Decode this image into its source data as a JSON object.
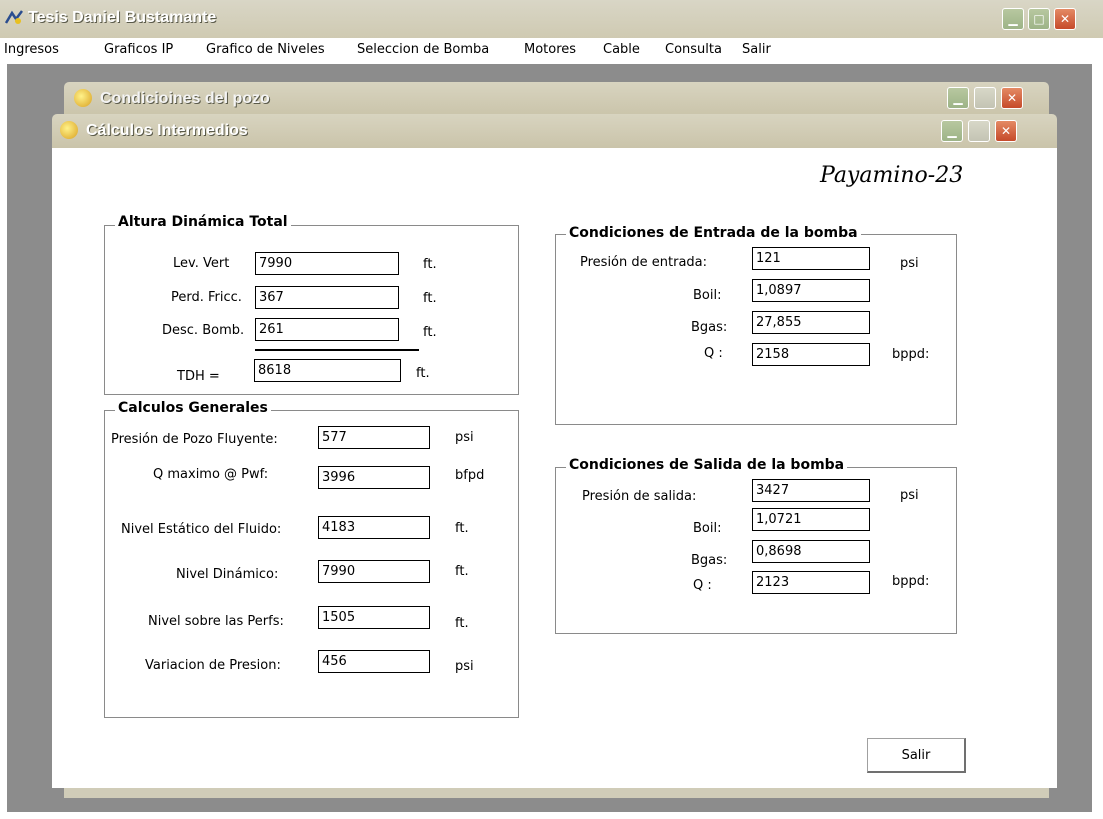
{
  "main_window": {
    "title": "Tesis Daniel Bustamante"
  },
  "menu": [
    "Ingresos",
    "Graficos IP",
    "Grafico de Niveles",
    "Seleccion de Bomba",
    "Motores",
    "Cable",
    "Consulta",
    "Salir"
  ],
  "bg_window": {
    "title": "Condicioines del pozo"
  },
  "calc_window": {
    "title": "Cálculos Intermedios",
    "well_name": "Payamino-23",
    "tdh": {
      "label": "Altura Dinámica Total",
      "rows": [
        {
          "label": "Lev. Vert",
          "value": "7990",
          "unit": "ft."
        },
        {
          "label": "Perd. Fricc.",
          "value": "367",
          "unit": "ft."
        },
        {
          "label": "Desc. Bomb.",
          "value": "261",
          "unit": "ft."
        }
      ],
      "total": {
        "label": "TDH =",
        "value": "8618",
        "unit": "ft."
      }
    },
    "general": {
      "label": "Calculos Generales",
      "rows": [
        {
          "label": "Presión de Pozo Fluyente:",
          "value": "577",
          "unit": "psi"
        },
        {
          "label": "Q maximo @ Pwf:",
          "value": "3996",
          "unit": "bfpd"
        },
        {
          "label": "Nivel Estático del Fluido:",
          "value": "4183",
          "unit": "ft."
        },
        {
          "label": "Nivel Dinámico:",
          "value": "7990",
          "unit": "ft."
        },
        {
          "label": "Nivel sobre las Perfs:",
          "value": "1505",
          "unit": "ft."
        },
        {
          "label": "Variacion de Presion:",
          "value": "456",
          "unit": "psi"
        }
      ]
    },
    "intake": {
      "label": "Condiciones de Entrada de la bomba",
      "rows": [
        {
          "label": "Presión de entrada:",
          "value": "121",
          "unit": "psi"
        },
        {
          "label": "Boil:",
          "value": "1,0897",
          "unit": ""
        },
        {
          "label": "Bgas:",
          "value": "27,855",
          "unit": ""
        },
        {
          "label": "Q :",
          "value": "2158",
          "unit": "bppd:"
        }
      ]
    },
    "discharge": {
      "label": "Condiciones de Salida de la bomba",
      "rows": [
        {
          "label": "Presión de salida:",
          "value": "3427",
          "unit": "psi"
        },
        {
          "label": "Boil:",
          "value": "1,0721",
          "unit": ""
        },
        {
          "label": "Bgas:",
          "value": "0,8698",
          "unit": ""
        },
        {
          "label": "Q :",
          "value": "2123",
          "unit": "bppd:"
        }
      ]
    },
    "exit_button": "Salir"
  }
}
